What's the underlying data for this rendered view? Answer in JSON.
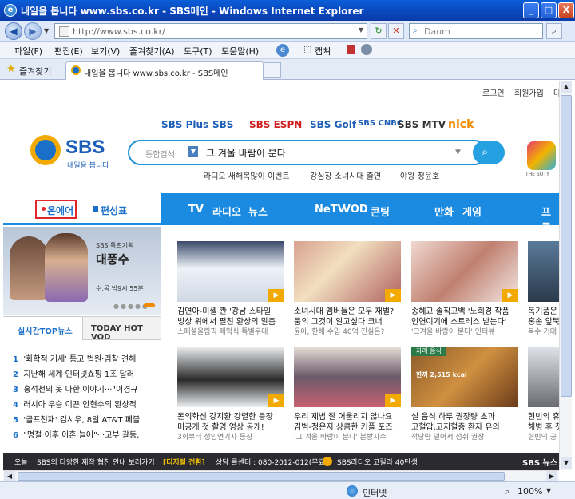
{
  "window": {
    "title": "내일을 봅니다 www.sbs.co.kr - SBS메인 - Windows Internet Explorer",
    "minimize": "_",
    "maximize": "□",
    "close": "X"
  },
  "address": {
    "url": "http://www.sbs.co.kr/",
    "search_placeholder": "Daum",
    "back": "◀",
    "forward": "▶",
    "refresh": "↻",
    "stop": "✕"
  },
  "menu": [
    "파일(F)",
    "편집(E)",
    "보기(V)",
    "즐겨찾기(A)",
    "도구(T)",
    "도움말(H)"
  ],
  "toolbar_right": {
    "capture_label": "캡쳐"
  },
  "tabs": {
    "favorites_label": "즐겨찾기",
    "active_tab": "내일을 봅니다 www.sbs.co.kr - SBS메인"
  },
  "page": {
    "top_links": [
      "로그인",
      "회원가입",
      "마"
    ],
    "logo_text": "SBS",
    "logo_slogan": "내일을 봅니다",
    "channels": [
      "SBS Plus",
      "SBS",
      "SBS ESPN",
      "SBS Golf",
      "SBS CNBC",
      "SBS MTV",
      "nick"
    ],
    "search_category": "통합검색",
    "search_value": "그 겨울 바람이 분다",
    "search_suggestions": [
      "라디오 새해복많이 이벤트",
      "강심장 소녀시대 출연",
      "야왕 정윤호"
    ],
    "nav_left": {
      "onair": "온에어",
      "schedule": "편성표"
    },
    "nav_main": [
      "TV",
      "라디오",
      "뉴스",
      "NeTV",
      "VOD",
      "콘팅",
      "만화",
      "게임",
      "프로"
    ],
    "feature": {
      "label": "SBS 특별기획",
      "title": "대풍수",
      "time": "수,목 밤9시 55분"
    },
    "side_tabs": [
      "실시간TOP뉴스",
      "TODAY HOT VOD"
    ],
    "news": [
      {
        "num": "1",
        "text": "'화학적 거세' 통고 법원·검찰 견해"
      },
      {
        "num": "2",
        "text": "지난해 세계 인터넷쇼핑 1조 달러"
      },
      {
        "num": "3",
        "text": "홍석천의 못 다한 이야기···\"이경규"
      },
      {
        "num": "4",
        "text": "러시아 우승 이끈 안현수의 환상적"
      },
      {
        "num": "5",
        "text": "'골프천재' 김시우, 8일 AT&T 페블"
      },
      {
        "num": "6",
        "text": "\"명절 이후 이혼 늘어\"···고부 갈등,"
      }
    ],
    "videos": [
      {
        "title": "김연아-미셸 콴 '강남 스타일'",
        "line2": "빙상 위에서 펼친 환상의 말춤",
        "sub": "스페셜올림픽 폐막식 특별무대"
      },
      {
        "title": "소녀시대 멤버들은 모두 재벌?",
        "line2": "뭄의 그것이 알고싶다 코너",
        "sub": "윤아, 한해 수입 40억 진실은?"
      },
      {
        "title": "송혜교 솔직고백 '노희경 작품",
        "line2": "인연이기에 스트레스 받는다'",
        "sub": "'그겨울 바람이 분다' 인터뷰"
      },
      {
        "title": "독기품은",
        "line2": "홍손 앞뚝",
        "sub": "복수 기대"
      },
      {
        "title": "돈의화신 강지환 강렬한 등장",
        "line2": "미공개 첫 촬영 영상 공개!",
        "sub": "3회부터 성인연기자 등장"
      },
      {
        "title": "우리 제법 잘 어울리지 않나요",
        "line2": "김범-정은지 상큼한 커플 포즈",
        "sub": "'그 겨울 바람이 분다' 본방사수"
      },
      {
        "title": "설 음식 하루 권장량 초과",
        "line2": "고혈압,고지혈증 환자 유의",
        "sub": "적당량 덜어서 섭취 권장"
      },
      {
        "title": "현빈의 휴",
        "line2": "해병 후 첫",
        "sub": "현빈의 공"
      }
    ],
    "food_label": "차례 음식",
    "food_kcal": "한끼 2,515 kcal",
    "bottom": {
      "left": "오늘",
      "notice": "SBS의 다양한 제작 협찬 안내 보러가기",
      "highlight": "[디지털 전환]",
      "call": "상담 콜센터 : 080-2012-012(무료)",
      "radio": "SBS라디오 고릴라 40탄생",
      "right": "SBS 뉴스"
    },
    "soty_caption": "THE SOTY"
  },
  "status": {
    "zone": "인터넷",
    "zoom": "100%"
  },
  "colors": {
    "sbs_blue": "#1a8be0",
    "nav_red": "#e0262a",
    "ie_blue": "#0a48c0"
  }
}
